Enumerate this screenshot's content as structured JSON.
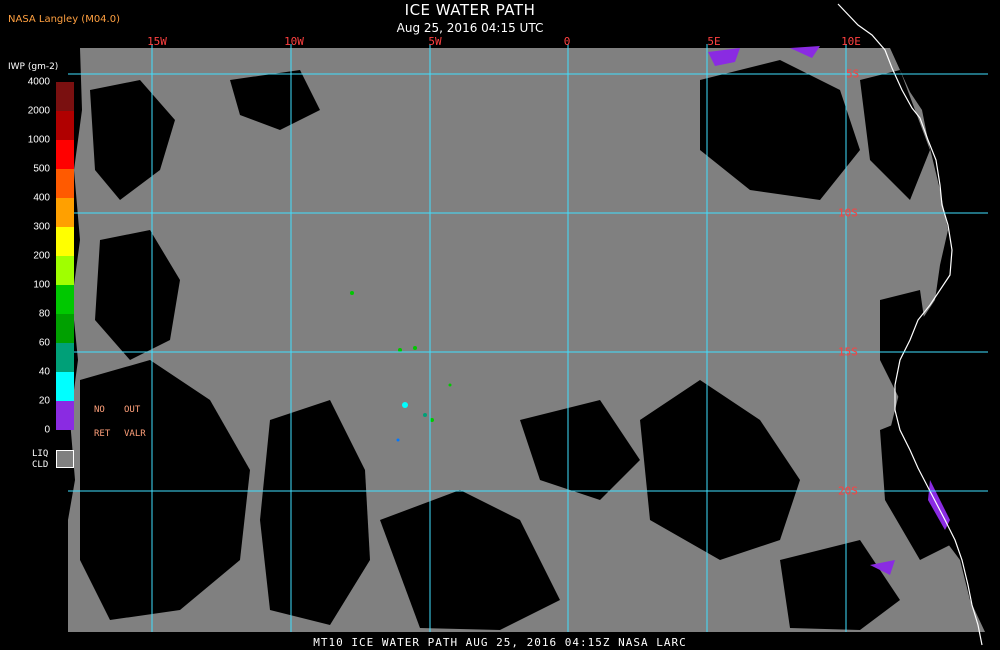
{
  "header": {
    "agency": "NASA Langley (M04.0)",
    "title": "ICE WATER PATH",
    "subtitle": "Aug 25, 2016 04:15 UTC"
  },
  "legend": {
    "unit_label": "IWP (gm-2)",
    "levels": [
      {
        "label": "4000",
        "color": "#7a1010"
      },
      {
        "label": "2000",
        "color": "#b00000"
      },
      {
        "label": "1000",
        "color": "#ff0000"
      },
      {
        "label": "500",
        "color": "#ff5a00"
      },
      {
        "label": "400",
        "color": "#ffa000"
      },
      {
        "label": "300",
        "color": "#ffff00"
      },
      {
        "label": "200",
        "color": "#a0ff00"
      },
      {
        "label": "100",
        "color": "#00c800"
      },
      {
        "label": "80",
        "color": "#00a000"
      },
      {
        "label": "60",
        "color": "#00a078"
      },
      {
        "label": "40",
        "color": "#00ffff"
      },
      {
        "label": "20",
        "color": "#0078ff"
      },
      {
        "label": "0",
        "color": "#0000ff"
      }
    ],
    "bottom_color": "#8a2be2",
    "no_label": "NO",
    "out_label": "OUT",
    "ret_label": "RET",
    "valr_label": "VALR",
    "liq_label": "LIQ",
    "cld_label": "CLD",
    "liq_color": "#808080"
  },
  "map": {
    "background_color": "#000000",
    "cloud_color": "#808080",
    "grid_color": "#40e0ff",
    "coast_color": "#ffffff",
    "label_color": "#ff4040",
    "longitude_labels": [
      "15W",
      "10W",
      "5W",
      "0",
      "5E",
      "10E"
    ],
    "latitude_labels": [
      "5S",
      "10S",
      "15S",
      "20S"
    ]
  },
  "footer": {
    "text": "MT10  ICE WATER PATH  AUG 25, 2016 04:15Z  NASA LARC"
  }
}
